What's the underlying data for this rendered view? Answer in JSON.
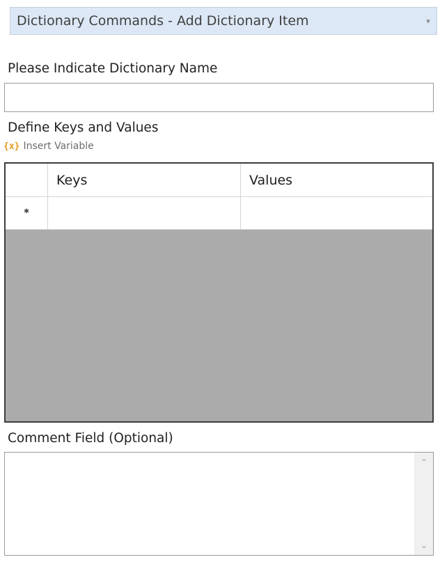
{
  "command": {
    "selected": "Dictionary Commands - Add Dictionary Item",
    "dropdown_icon": "chevron-down-icon"
  },
  "dictionary_name": {
    "label": "Please Indicate Dictionary Name",
    "value": ""
  },
  "keys_values": {
    "label": "Define Keys and Values",
    "insert_variable": {
      "icon_text": "{x}",
      "label": "Insert Variable"
    },
    "grid": {
      "columns": [
        "Keys",
        "Values"
      ],
      "new_row_marker": "*",
      "rows": []
    }
  },
  "comment": {
    "label": "Comment Field (Optional)",
    "value": "",
    "scroll_up_icon": "scroll-up-icon",
    "scroll_down_icon": "scroll-down-icon"
  }
}
